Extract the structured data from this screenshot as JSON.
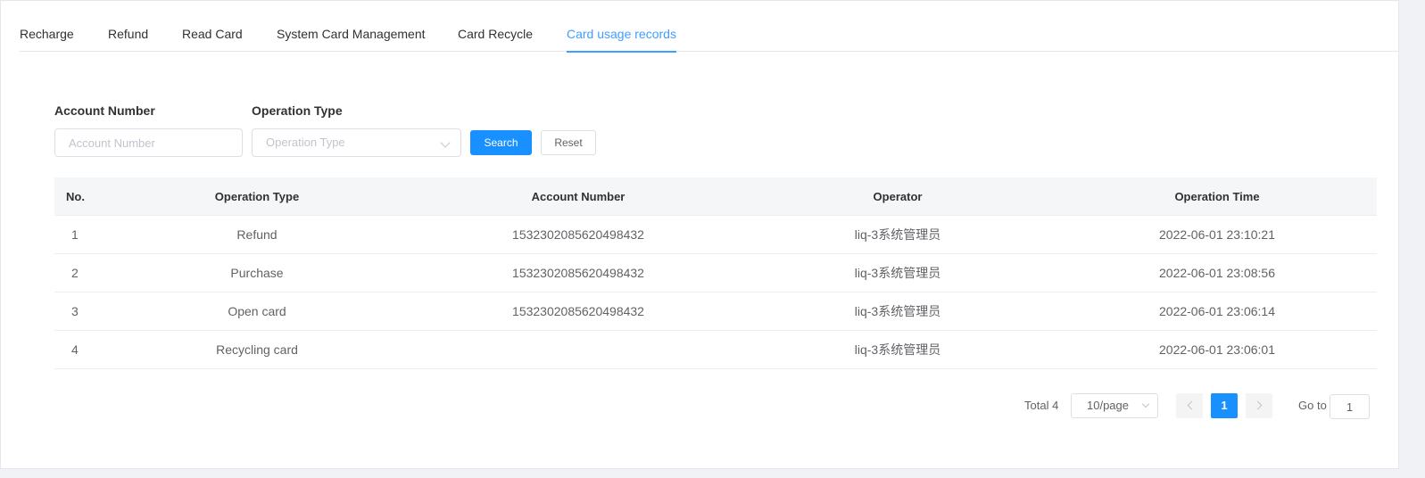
{
  "tabs": [
    {
      "label": "Recharge"
    },
    {
      "label": "Refund"
    },
    {
      "label": "Read Card"
    },
    {
      "label": "System Card Management"
    },
    {
      "label": "Card Recycle"
    },
    {
      "label": "Card usage records",
      "active": true
    }
  ],
  "filters": {
    "account_label": "Account Number",
    "account_placeholder": "Account Number",
    "account_value": "",
    "optype_label": "Operation Type",
    "optype_placeholder": "Operation Type",
    "search_label": "Search",
    "reset_label": "Reset"
  },
  "table": {
    "headers": {
      "no": "No.",
      "operation_type": "Operation Type",
      "account_number": "Account Number",
      "operator": "Operator",
      "operation_time": "Operation Time"
    },
    "rows": [
      {
        "no": "1",
        "operation_type": "Refund",
        "account_number": "1532302085620498432",
        "operator": "liq-3系统管理员",
        "operation_time": "2022-06-01 23:10:21"
      },
      {
        "no": "2",
        "operation_type": "Purchase",
        "account_number": "1532302085620498432",
        "operator": "liq-3系统管理员",
        "operation_time": "2022-06-01 23:08:56"
      },
      {
        "no": "3",
        "operation_type": "Open card",
        "account_number": "1532302085620498432",
        "operator": "liq-3系统管理员",
        "operation_time": "2022-06-01 23:06:14"
      },
      {
        "no": "4",
        "operation_type": "Recycling card",
        "account_number": "",
        "operator": "liq-3系统管理员",
        "operation_time": "2022-06-01 23:06:01"
      }
    ]
  },
  "pagination": {
    "total_text": "Total 4",
    "page_size": "10/page",
    "current_page": "1",
    "goto_label": "Go to",
    "goto_value": "1"
  },
  "colors": {
    "accent": "#1890ff",
    "tab_active": "#409eff"
  },
  "icons": {
    "select_arrow": "chevron-down-icon",
    "prev": "chevron-left-icon",
    "next": "chevron-right-icon"
  }
}
